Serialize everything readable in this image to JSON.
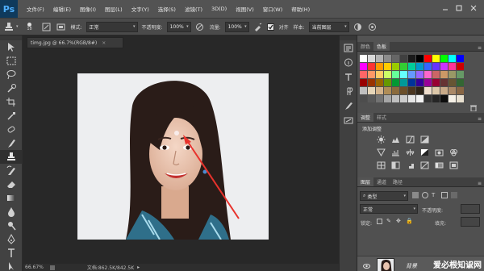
{
  "app": {
    "logo": "Ps"
  },
  "menu": {
    "items": [
      "文件(F)",
      "编辑(E)",
      "图像(I)",
      "图层(L)",
      "文字(Y)",
      "选择(S)",
      "滤镜(T)",
      "3D(D)",
      "视图(V)",
      "窗口(W)",
      "帮助(H)"
    ]
  },
  "options": {
    "brush_size": "18",
    "mode_label": "模式:",
    "mode_value": "正常",
    "opacity_label": "不透明度:",
    "opacity_value": "100%",
    "flow_label": "流量:",
    "flow_value": "100%",
    "align_label": "对齐",
    "sample_label": "样本:",
    "sample_value": "当前图层"
  },
  "document": {
    "tab_title": "timg.jpg @ 66.7%(RGB/8#)",
    "tab_close": "×",
    "status_zoom": "66.67%",
    "status_doc": "文档:862.5K/842.5K"
  },
  "panels": {
    "swatch_tabs": [
      "颜色",
      "色板"
    ],
    "adjust_tabs": [
      "调整",
      "样式"
    ],
    "adjust_title": "添加调整",
    "layer_tabs": [
      "图层",
      "通道",
      "路径"
    ],
    "kind_value": "类型",
    "blend_value": "正常",
    "layer_opacity_label": "不透明度:",
    "lock_label": "锁定:",
    "fill_label": "填充:",
    "layer_name": "背景"
  },
  "watermark": "爱必根知识网",
  "colors": {
    "swatches": [
      "#ffffff",
      "#d9d9d9",
      "#b3b3b3",
      "#8c8c8c",
      "#666666",
      "#404040",
      "#1a1a1a",
      "#000000",
      "#ff0000",
      "#ffff00",
      "#00ff00",
      "#00ffff",
      "#0000ff",
      "#ff00ff",
      "#ff3333",
      "#ff9900",
      "#ffcc00",
      "#99cc00",
      "#33cc33",
      "#00cc99",
      "#0099cc",
      "#3366ff",
      "#6633ff",
      "#cc33ff",
      "#ff3399",
      "#cc0000",
      "#ff6666",
      "#ff9966",
      "#ffcc66",
      "#ccff66",
      "#66ff99",
      "#66ffff",
      "#6699ff",
      "#9966ff",
      "#ff66cc",
      "#cc6666",
      "#cc9966",
      "#999966",
      "#669966",
      "#990000",
      "#993300",
      "#996600",
      "#669900",
      "#009933",
      "#009999",
      "#003399",
      "#330099",
      "#990099",
      "#990033",
      "#663333",
      "#665533",
      "#336633",
      "#c0c0c0",
      "#e6d5b8",
      "#d4b48c",
      "#b08d57",
      "#8b6b3d",
      "#6b4f2a",
      "#4a3620",
      "#2e2418",
      "#eeddcc",
      "#ddc8aa",
      "#c8aa88",
      "#aa8866",
      "#886644",
      "#4d4d4d",
      "#595959",
      "#737373",
      "#a6a6a6",
      "#bfbfbf",
      "#cccccc",
      "#e6e6e6",
      "#f2f2f2",
      "#333333",
      "#262626",
      "#0d0d0d",
      "#f5f0e6",
      "#e8e0d0"
    ]
  }
}
